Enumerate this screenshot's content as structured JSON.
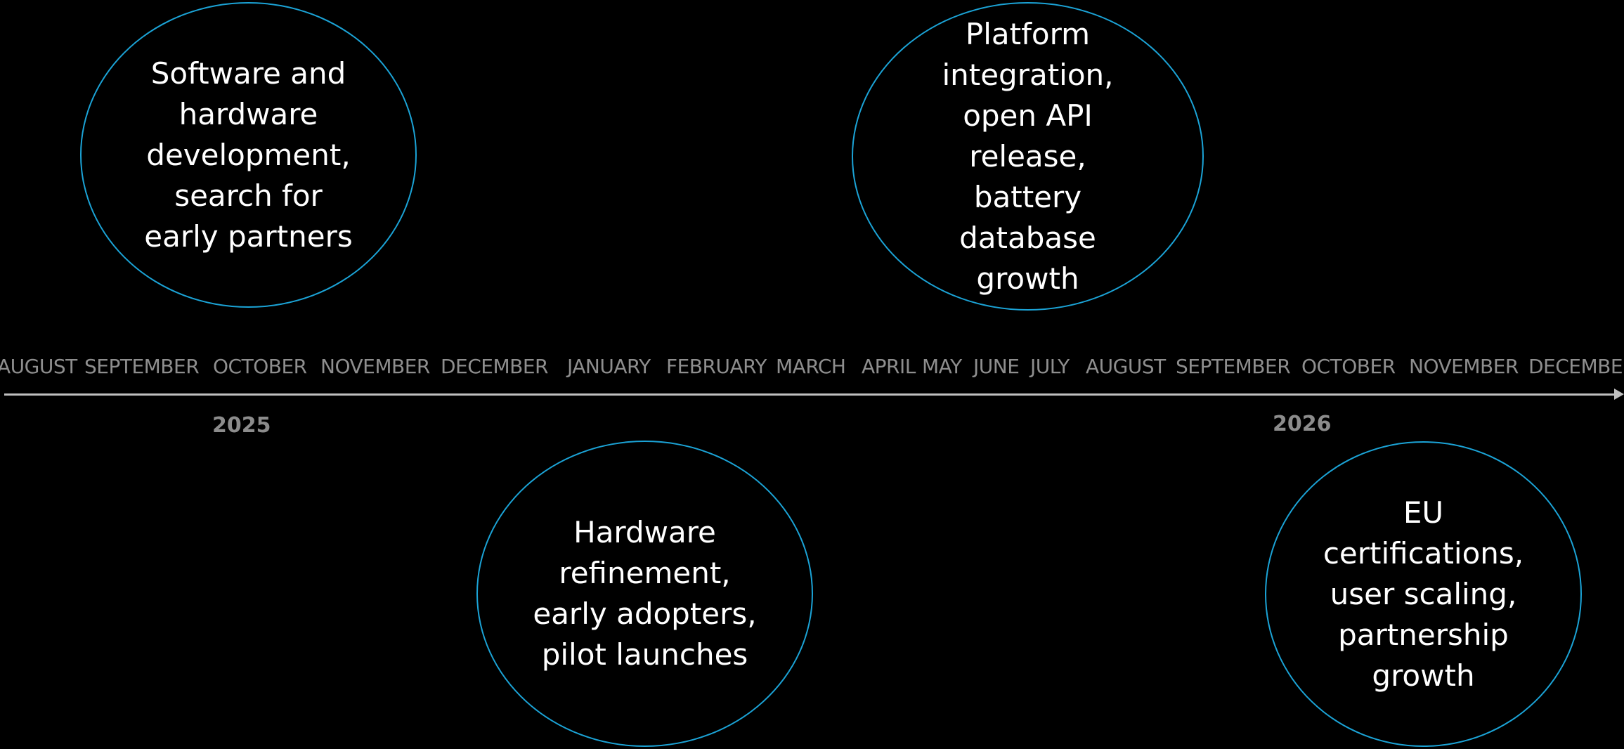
{
  "milestones": [
    {
      "text": "Software and hardware development, search for early partners"
    },
    {
      "text": "Platform integration, open API release, battery database growth"
    },
    {
      "text": "Hardware refinement, early adopters, pilot launches"
    },
    {
      "text": "EU certifications, user scaling, partnership growth"
    }
  ],
  "timeline": {
    "months": [
      "AUGUST",
      "SEPTEMBER",
      "OCTOBER",
      "NOVEMBER",
      "DECEMBER",
      "JANUARY",
      "FEBRUARY",
      "MARCH",
      "APRIL",
      "MAY",
      "JUNE",
      "JULY",
      "AUGUST",
      "SEPTEMBER",
      "OCTOBER",
      "NOVEMBER",
      "DECEMBER"
    ],
    "years": [
      "2025",
      "2026"
    ]
  },
  "colors": {
    "background": "#000000",
    "circle_border": "#1ba3d6",
    "milestone_text": "#ffffff",
    "month_text": "#8e8e8e",
    "axis_line": "#bfbfbf",
    "year_text": "#8c8c8c"
  }
}
